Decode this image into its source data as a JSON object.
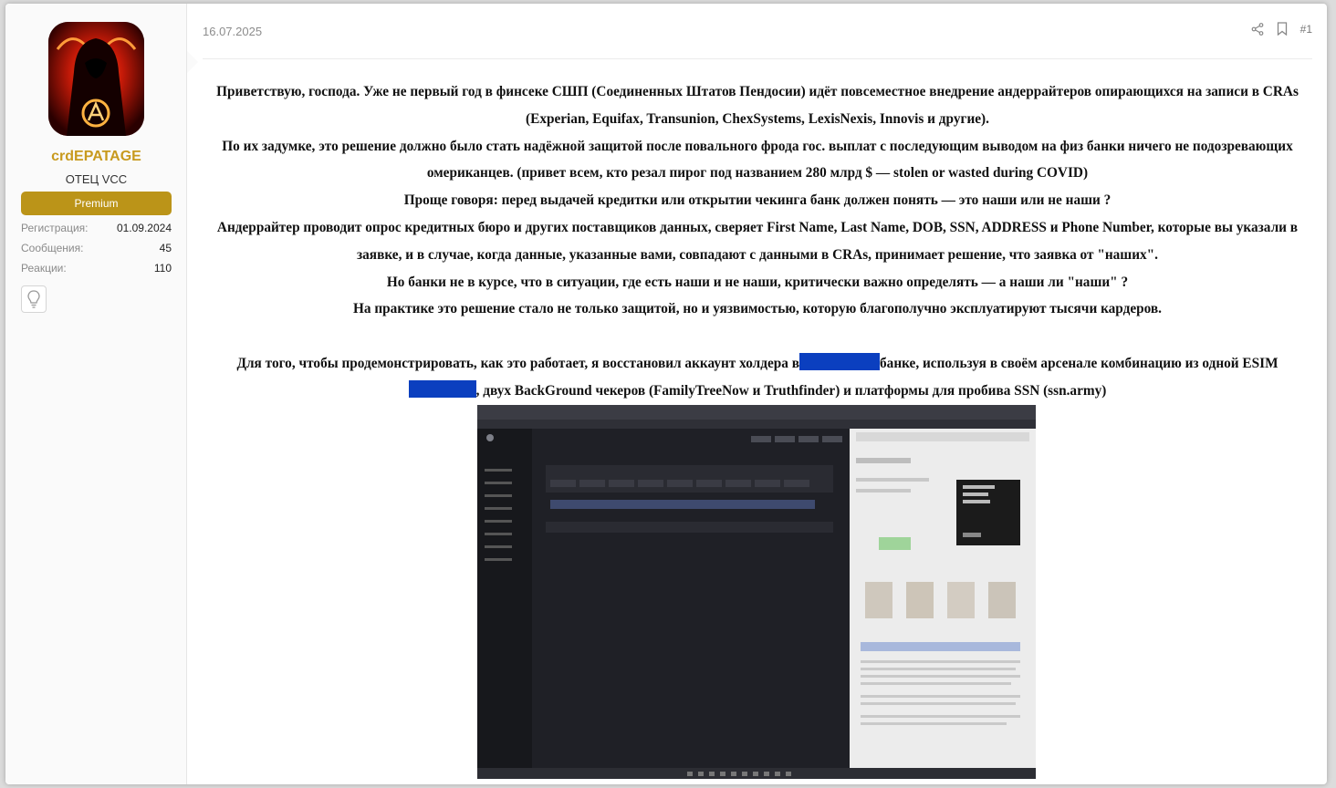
{
  "user": {
    "username": "crdEPATAGE",
    "title": "ОТЕЦ VCC",
    "badge": "Premium",
    "stats": [
      {
        "label": "Регистрация:",
        "value": "01.09.2024"
      },
      {
        "label": "Сообщения:",
        "value": "45"
      },
      {
        "label": "Реакции:",
        "value": "110"
      }
    ]
  },
  "post": {
    "date": "16.07.2025",
    "number": "#1",
    "paragraphs": [
      "Приветствую, господа. Уже не первый год в финсеке СШП (Соединенных Штатов Пендосии) идёт повсеместное внедрение андеррайтеров опирающихся на записи в CRAs (Experian, Equifax, Transunion, ChexSystems, LexisNexis, Innovis и другие).",
      "По их задумке, это решение должно было стать надёжной защитой после повального фрода гос. выплат с последующим выводом на физ банки ничего не подозревающих омериканцев. (привет всем, кто резал пирог под названием 280 млрд $ — stolen or wasted during COVID)",
      "Проще говоря: перед выдачей кредитки или открытии чекинга банк должен понять — это наши или не наши ?",
      "Андеррайтер проводит опрос кредитных бюро и других поставщиков данных, сверяет First Name, Last Name, DOB, SSN, ADDRESS и Phone Number, которые вы указали в заявке, и в случае, когда данные, указанные вами, совпадают с данными в CRAs, принимает решение, что заявка от \"наших\".",
      "Но банки не в курсе, что в ситуации, где есть наши и не наши, критически важно определять — а наши ли \"наши\" ?",
      "На практике это решение стало не только защитой, но и уязвимостью, которую благополучно эксплуатируют тысячи кардеров."
    ],
    "last_part_a": "Для того, чтобы продемонстрировать, как это работает, я восстановил аккаунт холдера в",
    "last_part_b": "банке, используя в своём арсенале комбинацию из одной ESIM",
    "last_part_c": ", двух BackGround чекеров (FamilyTreeNow и Truthfinder) и платформы для пробива SSN (ssn.army)"
  },
  "colors": {
    "accent_gold": "#c89a1e",
    "badge_gold": "#bb9418",
    "redaction_blue": "#0b3fbf"
  },
  "icons": [
    "share-icon",
    "bookmark-icon",
    "lightbulb-icon"
  ]
}
